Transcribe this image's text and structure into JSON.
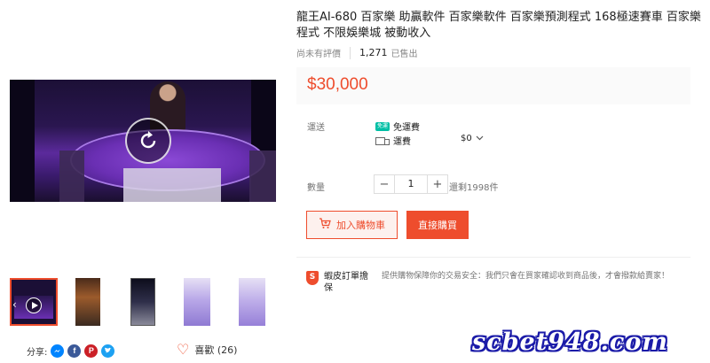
{
  "product": {
    "title": "龍王AI-680 百家樂 助贏軟件 百家樂軟件 百家樂預測程式 168極速賽車 百家樂程式 不限娛樂城 被動收入",
    "rating_text": "尚未有評價",
    "sold_count": "1,271",
    "sold_label": "已售出",
    "price": "$30,000",
    "accent_color": "#ee4d2d"
  },
  "shipping": {
    "label": "運送",
    "free_badge": "免運",
    "free_label": "免運費",
    "fee_label": "運費",
    "fee_value": "$0",
    "truck_icon": "truck-icon"
  },
  "quantity": {
    "label": "數量",
    "value": "1",
    "minus": "−",
    "plus": "+",
    "stock_text": "還剩1998件"
  },
  "actions": {
    "add_to_cart": "加入購物車",
    "buy_now": "直接購買",
    "cart_icon": "cart-icon"
  },
  "guarantee": {
    "label": "蝦皮訂單擔保",
    "description": "提供購物保障你的交易安全：我們只會在買家確認收到商品後，才會撥款給賣家！",
    "shield_letter": "S"
  },
  "social": {
    "share_label": "分享:",
    "like_label": "喜歡 (26)"
  },
  "watermark": "scbet948.com"
}
